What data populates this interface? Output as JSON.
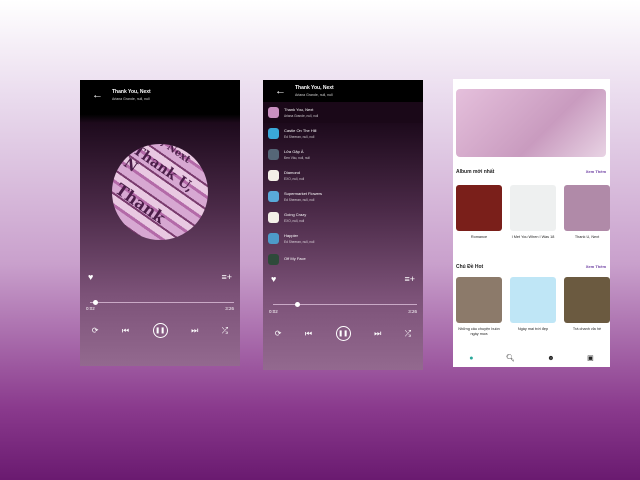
{
  "player": {
    "title": "Thank You, Next",
    "subtitle": "Ariana Grande, null, null",
    "current_time": "0:02",
    "duration": "3:26",
    "progress_percent": 1,
    "disc_text": [
      "Thank U, Next",
      "Thank",
      "U, N"
    ]
  },
  "queue": {
    "title": "Thank You, Next",
    "subtitle": "Ariana Grande, null, null",
    "current_time": "0:02",
    "duration": "3:26",
    "items": [
      {
        "title": "Thank You, Next",
        "artist": "Ariana Grande, null, null",
        "color": "#c98fc0"
      },
      {
        "title": "Castle On The Hill",
        "artist": "Ed Sheeran, null, null",
        "color": "#3aa8d8"
      },
      {
        "title": "Lửa Gặp Ẩ",
        "artist": "Đen Vâu, null, null",
        "color": "#556677"
      },
      {
        "title": "Diamond",
        "artist": "EXO, null, null",
        "color": "#f4f0e8"
      },
      {
        "title": "Supermarket Flowers",
        "artist": "Ed Sheeran, null, null",
        "color": "#59a9d9"
      },
      {
        "title": "Going Crazy",
        "artist": "EXO, null, null",
        "color": "#f4f0e8"
      },
      {
        "title": "Happier",
        "artist": "Ed Sheeran, null, null",
        "color": "#4d9bc9"
      },
      {
        "title": "Off My Face",
        "artist": "",
        "color": "#2e4a3a"
      }
    ]
  },
  "home": {
    "section1": {
      "title": "Album mới nhất",
      "more": "Xem Thêm",
      "items": [
        {
          "label": "Romance",
          "color": "#7a1f1a"
        },
        {
          "label": "I Met You When I Was 18",
          "color": "#eef0f0"
        },
        {
          "label": "Thank U, Next",
          "color": "#b08aa8"
        }
      ]
    },
    "section2": {
      "title": "Chủ Đề Hot",
      "more": "Xem Thêm",
      "items": [
        {
          "label": "Những câu chuyện buồn ngày mưa",
          "color": "#8c7a6a"
        },
        {
          "label": "Ngày mai trời đẹp",
          "color": "#bfe6f6"
        },
        {
          "label": "Trà chanh vỉa hè",
          "color": "#6b5a40"
        }
      ]
    },
    "nav": [
      "home-icon",
      "search-icon",
      "artist-icon",
      "library-icon"
    ],
    "accent": "#2aa89a"
  }
}
